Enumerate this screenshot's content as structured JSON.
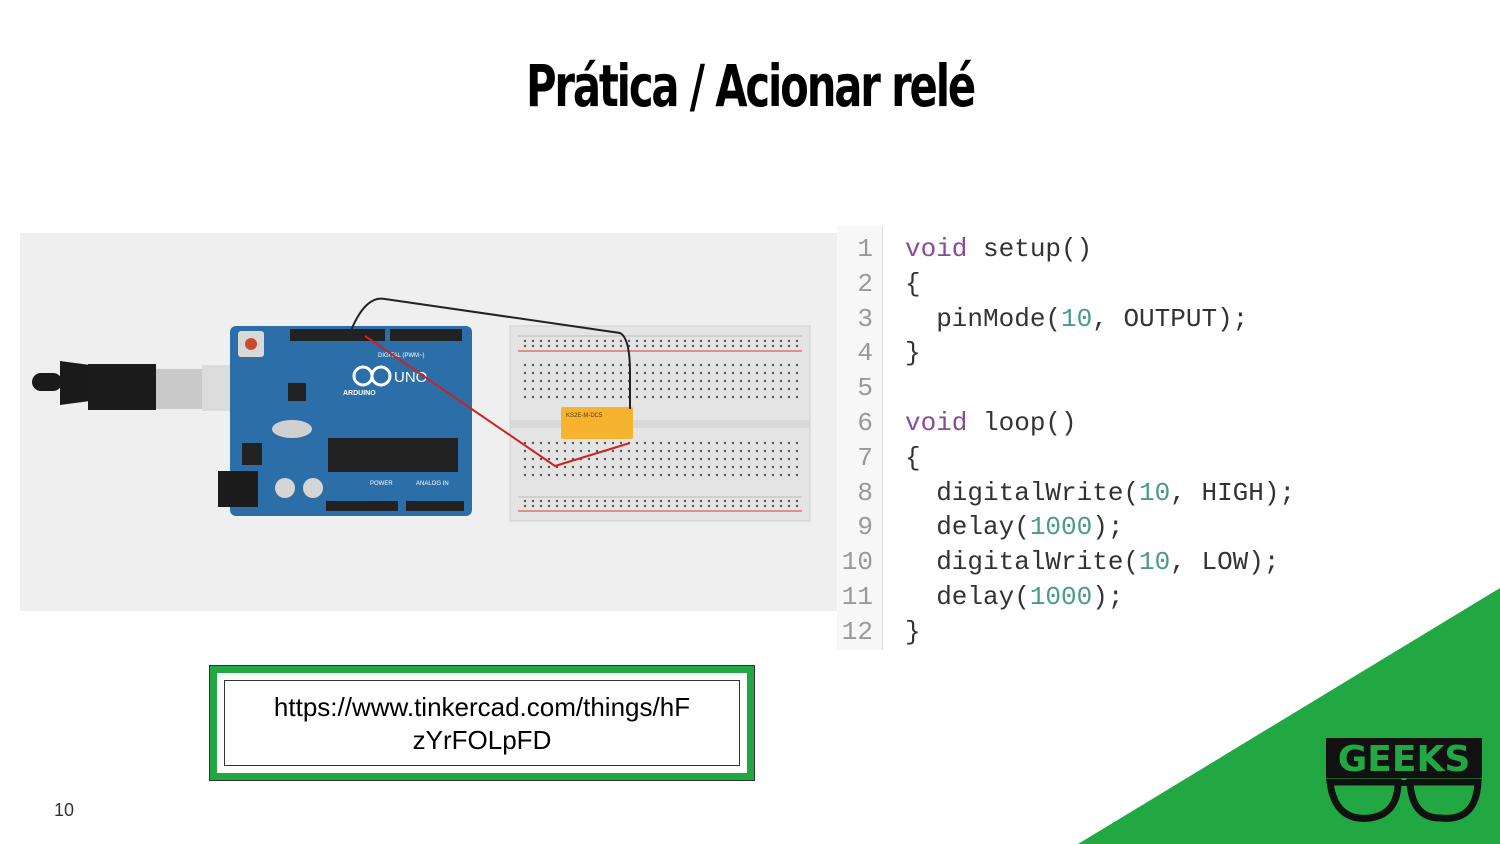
{
  "slide": {
    "title": "Prática / Acionar relé",
    "page_number": "10"
  },
  "code": {
    "lines": [
      {
        "n": "1",
        "pre": "",
        "kw": "void",
        "rest": " setup()"
      },
      {
        "n": "2",
        "text": "{"
      },
      {
        "n": "3",
        "text": "  pinMode(",
        "num": "10",
        "after": ", OUTPUT);"
      },
      {
        "n": "4",
        "text": "}"
      },
      {
        "n": "5",
        "text": ""
      },
      {
        "n": "6",
        "pre": "",
        "kw": "void",
        "rest": " loop()"
      },
      {
        "n": "7",
        "text": "{"
      },
      {
        "n": "8",
        "text": "  digitalWrite(",
        "num": "10",
        "after": ", HIGH);"
      },
      {
        "n": "9",
        "text": "  delay(",
        "num": "1000",
        "after": ");"
      },
      {
        "n": "10",
        "text": "  digitalWrite(",
        "num": "10",
        "after": ", LOW);"
      },
      {
        "n": "11",
        "text": "  delay(",
        "num": "1000",
        "after": ");"
      },
      {
        "n": "12",
        "text": "}"
      }
    ]
  },
  "link": {
    "line1": "https://www.tinkercad.com/things/hF",
    "line2": "zYrFOLpFD"
  },
  "circuit": {
    "board_brand": "UNO",
    "board_name": "ARDUINO",
    "header_digital": "DIGITAL (PWM~)",
    "header_power": "POWER",
    "header_analog": "ANALOG IN",
    "relay_label": "KS2E-M-DC5"
  },
  "logo": {
    "text": "GEEKS"
  },
  "colors": {
    "accent_green": "#22a842",
    "board_blue": "#2b6ea8",
    "wire_red": "#cc2222",
    "wire_black": "#222222",
    "relay_orange": "#f5b330",
    "keyword_purple": "#8a4a9a",
    "number_teal": "#4a9a8a"
  }
}
